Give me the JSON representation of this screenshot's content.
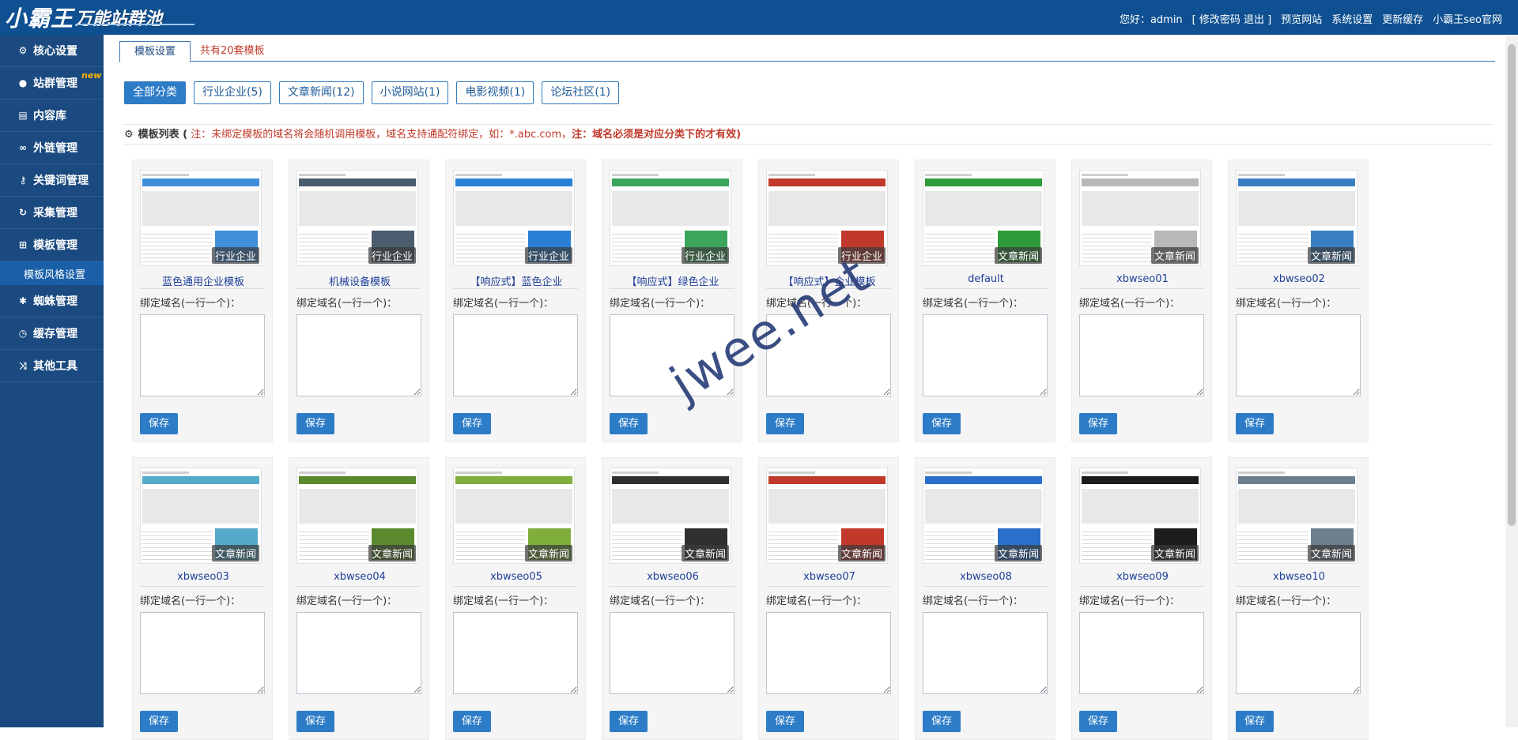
{
  "header": {
    "logo_main": "小霸王",
    "logo_sub": "万能站群池",
    "greeting": "您好：admin",
    "account_links": "[ 修改密码 退出 ]",
    "links": [
      "预览网站",
      "系统设置",
      "更新缓存",
      "小霸王seo官网"
    ]
  },
  "sidebar": {
    "items": [
      {
        "label": "核心设置",
        "icon": "gear-icon"
      },
      {
        "label": "站群管理",
        "icon": "user-icon",
        "badge": "new"
      },
      {
        "label": "内容库",
        "icon": "document-icon"
      },
      {
        "label": "外链管理",
        "icon": "link-icon"
      },
      {
        "label": "关键词管理",
        "icon": "key-icon"
      },
      {
        "label": "采集管理",
        "icon": "refresh-icon"
      },
      {
        "label": "模板管理",
        "icon": "windows-icon"
      },
      {
        "label": "蜘蛛管理",
        "icon": "android-icon"
      },
      {
        "label": "缓存管理",
        "icon": "timer-icon"
      },
      {
        "label": "其他工具",
        "icon": "shuffle-icon"
      }
    ],
    "subitem": "模板风格设置"
  },
  "tabs": {
    "active": "模板设置",
    "info": "共有20套模板"
  },
  "filters": [
    {
      "label": "全部分类",
      "active": true
    },
    {
      "label": "行业企业(5)",
      "active": false
    },
    {
      "label": "文章新闻(12)",
      "active": false
    },
    {
      "label": "小说网站(1)",
      "active": false
    },
    {
      "label": "电影视频(1)",
      "active": false
    },
    {
      "label": "论坛社区(1)",
      "active": false
    }
  ],
  "notice": {
    "label": "模板列表 (",
    "note1": "注：未绑定模板的域名将会随机调用模板，域名支持通配符绑定，如：*.abc.com，",
    "note2": "注：域名必须是对应分类下的才有效)"
  },
  "card_common": {
    "bind_label": "绑定域名(一行一个)：",
    "save": "保存"
  },
  "templates": [
    {
      "name": "蓝色通用企业模板",
      "tag": "行业企业",
      "accent": "#3f8fd9"
    },
    {
      "name": "机械设备模板",
      "tag": "行业企业",
      "accent": "#4a5d6e"
    },
    {
      "name": "【响应式】蓝色企业",
      "tag": "行业企业",
      "accent": "#2a7fd4"
    },
    {
      "name": "【响应式】绿色企业",
      "tag": "行业企业",
      "accent": "#3aa55b"
    },
    {
      "name": "【响应式】企业模板",
      "tag": "行业企业",
      "accent": "#c0392b"
    },
    {
      "name": "default",
      "tag": "文章新闻",
      "accent": "#2e9b3a"
    },
    {
      "name": "xbwseo01",
      "tag": "文章新闻",
      "accent": "#b8b8b8"
    },
    {
      "name": "xbwseo02",
      "tag": "文章新闻",
      "accent": "#3a7fc2"
    },
    {
      "name": "xbwseo03",
      "tag": "文章新闻",
      "accent": "#55a9c9"
    },
    {
      "name": "xbwseo04",
      "tag": "文章新闻",
      "accent": "#5b8a2e"
    },
    {
      "name": "xbwseo05",
      "tag": "文章新闻",
      "accent": "#7fae3c"
    },
    {
      "name": "xbwseo06",
      "tag": "文章新闻",
      "accent": "#2f2f2f"
    },
    {
      "name": "xbwseo07",
      "tag": "文章新闻",
      "accent": "#c0392b"
    },
    {
      "name": "xbwseo08",
      "tag": "文章新闻",
      "accent": "#2a6fc9"
    },
    {
      "name": "xbwseo09",
      "tag": "文章新闻",
      "accent": "#1c1c1c"
    },
    {
      "name": "xbwseo10",
      "tag": "文章新闻",
      "accent": "#6d7f8f"
    }
  ],
  "watermark": "jwee.net"
}
